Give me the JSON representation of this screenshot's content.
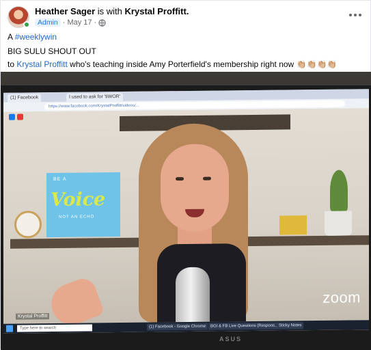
{
  "post": {
    "author": "Heather Sager",
    "with_text": "is with",
    "tagged": "Krystal Proffitt.",
    "role_badge": "Admin",
    "date": "May 17",
    "audience_icon": "globe-icon",
    "more_icon": "more-horizontal-icon",
    "line1_prefix": "A ",
    "hashtag": "#weeklywin",
    "line2": "BIG SULU SHOUT OUT",
    "line3_prefix": "to ",
    "mention": "Krystal Proffitt",
    "line3_suffix": " who's teaching inside Amy Porterfield's membership right now",
    "emoji": "👏🏼👏🏼👏🏼👏🏼"
  },
  "photo": {
    "browser_tab1": "(1) Facebook",
    "browser_tab2": "I used to ask for 'tiWOR'",
    "url": "https://www.facebook.com/KrystalProffitt/videos/...",
    "poster_top": "BE A",
    "poster_main": "Voice",
    "poster_bottom": "NOT AN ECHO",
    "video_caption": "Krystal Proffitt",
    "zoom_logo": "zoom",
    "taskbar_search": "Type here to search",
    "taskbar_items": [
      "(1) Facebook - Google Chrome",
      "BGI & FB Live Questions (Respons...",
      "Sticky Notes"
    ],
    "monitor_brand": "ASUS"
  },
  "colors": {
    "link": "#2267c8",
    "badge_bg": "#e7f3ff",
    "badge_text": "#1b74e4"
  }
}
